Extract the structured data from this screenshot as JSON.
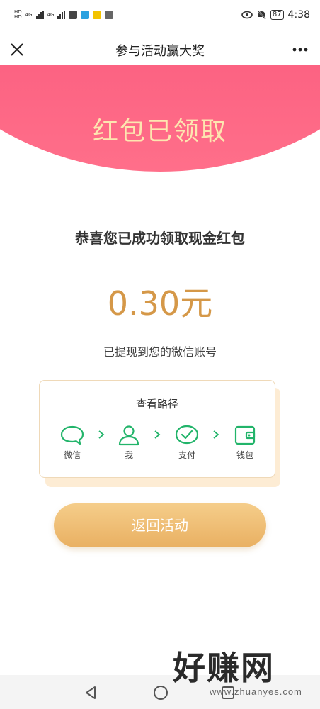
{
  "status_bar": {
    "network_1": "4G",
    "network_2": "4G",
    "battery": "87",
    "time": "4:38"
  },
  "nav": {
    "title": "参与活动赢大奖"
  },
  "banner": {
    "title": "红包已领取"
  },
  "result": {
    "congrats": "恭喜您已成功领取现金红包",
    "amount": "0.30元",
    "note": "已提现到您的微信账号"
  },
  "path_card": {
    "title": "查看路径",
    "steps": [
      {
        "label": "微信",
        "icon": "chat-bubble-icon"
      },
      {
        "label": "我",
        "icon": "person-icon"
      },
      {
        "label": "支付",
        "icon": "check-circle-icon"
      },
      {
        "label": "钱包",
        "icon": "wallet-icon"
      }
    ]
  },
  "actions": {
    "return_label": "返回活动"
  },
  "watermark": {
    "brand": "好赚网",
    "domain": "www.zhuanyes.com"
  },
  "colors": {
    "banner": "#f4406a",
    "banner_text": "#fde6b0",
    "amount": "#d59848",
    "green": "#22b46a",
    "button": "#eab566"
  }
}
